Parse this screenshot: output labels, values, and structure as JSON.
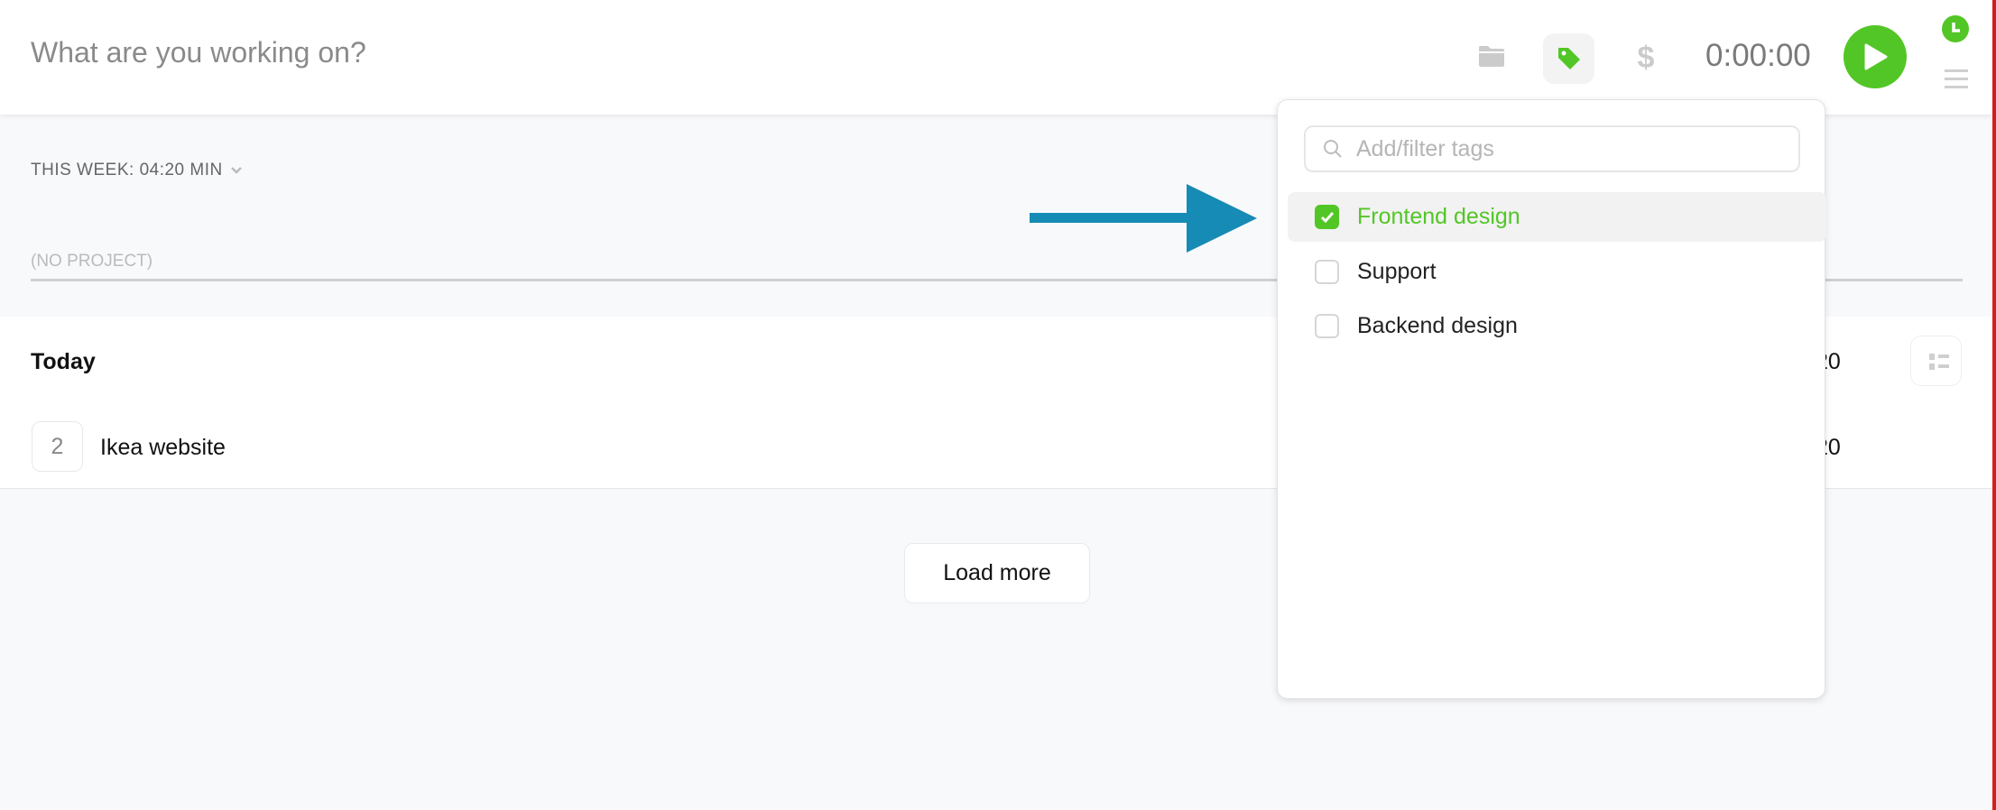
{
  "header": {
    "description_placeholder": "What are you working on?",
    "timer": "0:00:00",
    "icons": [
      "folder-icon",
      "tag-icon",
      "dollar-icon",
      "play-icon",
      "clock-icon",
      "menu-icon"
    ],
    "accent_color": "#52c626"
  },
  "summary": {
    "this_week": "THIS WEEK: 04:20 MIN",
    "project_label": "(NO PROJECT)"
  },
  "day": {
    "title": "Today",
    "total": "20",
    "entries": [
      {
        "count": "2",
        "description": "Ikea website",
        "duration": "20"
      }
    ]
  },
  "load_more": "Load more",
  "tag_dropdown": {
    "search_placeholder": "Add/filter tags",
    "tags": [
      {
        "label": "Frontend design",
        "checked": true
      },
      {
        "label": "Support",
        "checked": false
      },
      {
        "label": "Backend design",
        "checked": false
      }
    ]
  },
  "annotation": {
    "arrow_color": "#168bb5"
  }
}
